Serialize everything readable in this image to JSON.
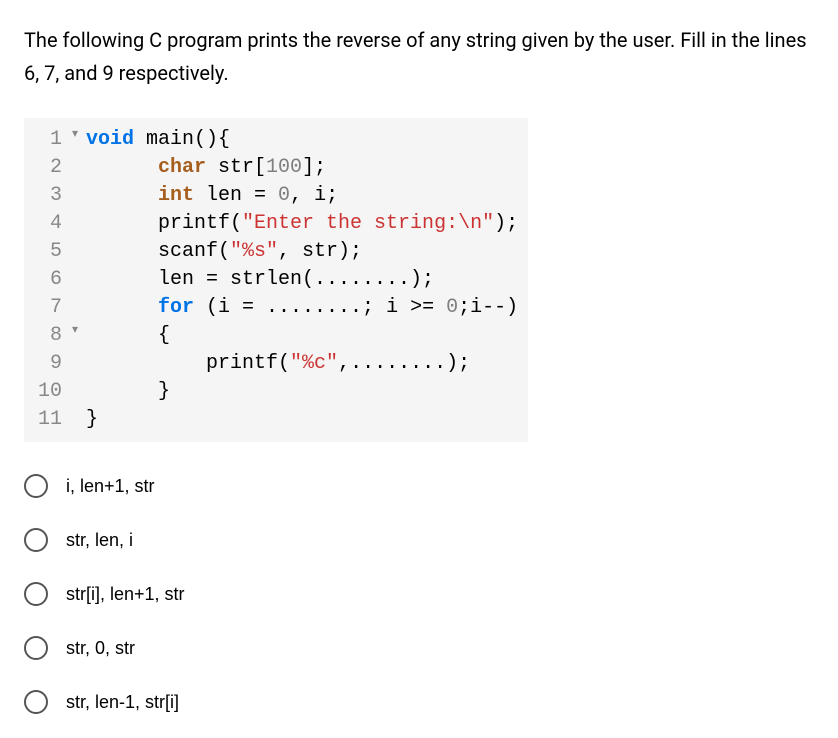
{
  "question": "The following C program prints the reverse of any string given by the user. Fill in the lines 6, 7, and 9 respectively.",
  "code": {
    "lines": [
      {
        "num": "1",
        "marker": "▾",
        "tokens": [
          [
            "kw",
            "void"
          ],
          [
            "plain",
            " main(){"
          ]
        ]
      },
      {
        "num": "2",
        "marker": " ",
        "tokens": [
          [
            "plain",
            "      "
          ],
          [
            "type",
            "char"
          ],
          [
            "plain",
            " str["
          ],
          [
            "num",
            "100"
          ],
          [
            "plain",
            "];"
          ]
        ]
      },
      {
        "num": "3",
        "marker": " ",
        "tokens": [
          [
            "plain",
            "      "
          ],
          [
            "type",
            "int"
          ],
          [
            "plain",
            " len = "
          ],
          [
            "num",
            "0"
          ],
          [
            "plain",
            ", i;"
          ]
        ]
      },
      {
        "num": "4",
        "marker": " ",
        "tokens": [
          [
            "plain",
            "      printf("
          ],
          [
            "str",
            "\"Enter the string:\\n\""
          ],
          [
            "plain",
            ");"
          ]
        ]
      },
      {
        "num": "5",
        "marker": " ",
        "tokens": [
          [
            "plain",
            "      scanf("
          ],
          [
            "str",
            "\"%s\""
          ],
          [
            "plain",
            ", str);"
          ]
        ]
      },
      {
        "num": "6",
        "marker": " ",
        "tokens": [
          [
            "plain",
            "      len = strlen(........);"
          ]
        ]
      },
      {
        "num": "7",
        "marker": " ",
        "tokens": [
          [
            "plain",
            "      "
          ],
          [
            "kw",
            "for"
          ],
          [
            "plain",
            " (i = ........; i >= "
          ],
          [
            "num",
            "0"
          ],
          [
            "plain",
            ";i--)"
          ]
        ]
      },
      {
        "num": "8",
        "marker": "▾",
        "tokens": [
          [
            "plain",
            "      {"
          ]
        ]
      },
      {
        "num": "9",
        "marker": " ",
        "tokens": [
          [
            "plain",
            "          printf("
          ],
          [
            "str",
            "\"%c\""
          ],
          [
            "plain",
            ",........);"
          ]
        ]
      },
      {
        "num": "10",
        "marker": " ",
        "tokens": [
          [
            "plain",
            "      }"
          ]
        ]
      },
      {
        "num": "11",
        "marker": " ",
        "tokens": [
          [
            "plain",
            "}"
          ]
        ]
      }
    ]
  },
  "options": [
    "i, len+1, str",
    "str, len, i",
    "str[i], len+1, str",
    "str, 0, str",
    "str, len-1, str[i]"
  ]
}
